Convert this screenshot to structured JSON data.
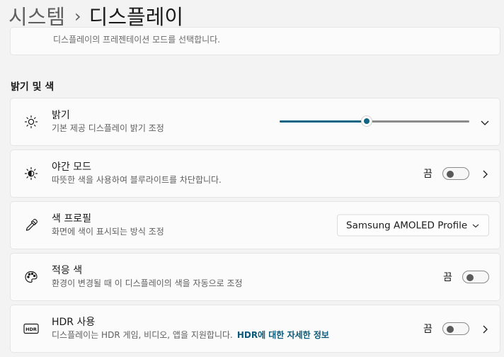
{
  "breadcrumb": {
    "parent": "시스템",
    "separator": "›",
    "current": "디스플레이"
  },
  "previous_card": {
    "subtitle": "디스플레이의 프레젠테이션 모드를 선택합니다."
  },
  "section": {
    "title": "밝기 및 색"
  },
  "brightness": {
    "title": "밝기",
    "subtitle": "기본 제공 디스플레이 밝기 조정",
    "value_percent": 46,
    "icon": "sun-icon"
  },
  "night_light": {
    "title": "야간 모드",
    "subtitle": "따뜻한 색을 사용하여 블루라이트를 차단합니다.",
    "state_label": "끔",
    "on": false,
    "icon": "night-light-icon"
  },
  "color_profile": {
    "title": "색 프로필",
    "subtitle": "화면에 색이 표시되는 방식 조정",
    "selected": "Samsung AMOLED Profile",
    "icon": "eyedropper-icon"
  },
  "adaptive_color": {
    "title": "적응 색",
    "subtitle": "환경이 변경될 때 이 디스플레이의 색을 자동으로 조정",
    "state_label": "끔",
    "on": false,
    "icon": "palette-icon"
  },
  "hdr": {
    "title": "HDR 사용",
    "subtitle": "디스플레이는 HDR 게임, 비디오, 앱을 지원합니다.",
    "link": "HDR에 대한 자세한 정보",
    "state_label": "끔",
    "on": false,
    "icon": "hdr-icon",
    "icon_text": "HDR"
  },
  "colors": {
    "accent": "#0f6583",
    "background": "#f3f3f3",
    "card": "#fbfbfb",
    "link": "#0b5a7a"
  }
}
